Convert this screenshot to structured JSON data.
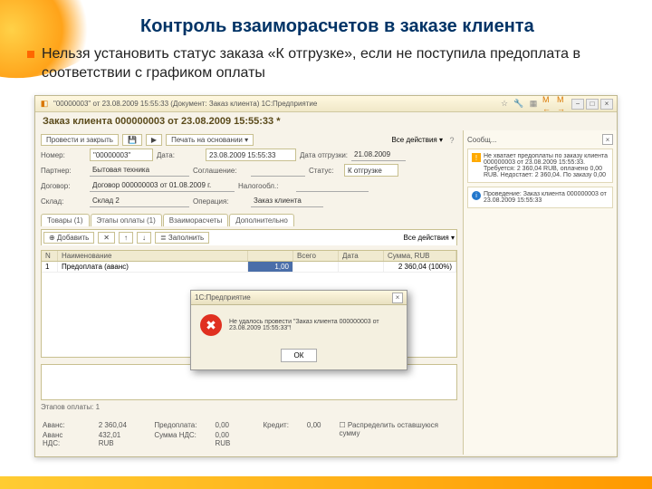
{
  "slide": {
    "title": "Контроль взаиморасчетов в заказе клиента",
    "bullet": "Нельзя установить статус заказа «К отгрузке», если не поступила предоплата в соответствии с графиком оплаты"
  },
  "window": {
    "titlebar": "\"00000003\" от 23.08.2009 15:55:33  (Документ: Заказ клиента)  1С:Предприятие",
    "nav_prev": "М ←",
    "nav_next": "М →",
    "min": "−",
    "max": "□",
    "close": "×"
  },
  "doc": {
    "title": "Заказ клиента 000000003 от 23.08.2009 15:55:33 *",
    "toolbar": {
      "post_close": "Провести и закрыть",
      "save_icon": "💾",
      "post_icon": "▶",
      "print": "Печать на основании ▾",
      "actions_label": "Все действия ▾",
      "help": "?"
    },
    "fields": {
      "number_label": "Номер:",
      "number": "\"00000003\"",
      "date_label": "Дата:",
      "date": "23.08.2009 15:55:33",
      "ship_label": "Дата отгрузки:",
      "ship": "21.08.2009",
      "partner_label": "Партнер:",
      "partner": "Бытовая техника",
      "agreement_label": "Соглашение:",
      "agreement": "",
      "contract_label": "Договор:",
      "contract": "Договор 000000003 от 01.08.2009 г.",
      "warehouse_label": "Склад:",
      "warehouse": "Склад 2",
      "status_label": "Статус:",
      "status": "К отгрузке",
      "tax_label": "Налогообл.:",
      "tax": "",
      "operation_label": "Операция:",
      "operation": "Заказ клиента"
    },
    "tabs": [
      "Товары (1)",
      "Этапы оплаты (1)",
      "Взаиморасчеты",
      "Дополнительно"
    ],
    "sub_toolbar": {
      "add": "⊕ Добавить",
      "del": "✕",
      "up": "↑",
      "down": "↓",
      "fill": "≣ Заполнить"
    },
    "table": {
      "headers": [
        "N",
        "Наименование",
        "",
        "Всего",
        "Дата",
        "Сумма, RUB"
      ],
      "row": {
        "n": "1",
        "name": "Предоплата (аванс)",
        "col3": "1,00",
        "total": "",
        "date": "",
        "sum": "2 360,04 (100%)"
      }
    },
    "bottom": {
      "items_label": "Этапов оплаты: 1",
      "rows": [
        {
          "label": "Аванс:",
          "val1": "2 360,04",
          "label2": "Предоплата:",
          "val2": "0,00",
          "label3": "Кредит:",
          "val3": "0,00",
          "check": "☐ Распределить оставшуюся сумму"
        },
        {
          "label": "Аванс НДС:",
          "val1": "432,01 RUB",
          "label2": "Сумма НДС:",
          "val2": "0,00 RUB"
        }
      ]
    }
  },
  "side": {
    "header": "Сообщ...",
    "close": "×",
    "msg1": {
      "icon": "!",
      "text": "Не хватает предоплаты по заказу клиента 000000003 от 23.08.2009 15:55:33. Требуется: 2 360,04 RUB, оплачено 0,00 RUB. Недостает: 2 360,04. По заказу 0,00"
    },
    "msg2": {
      "icon": "i",
      "text": "Проведение: Заказ клиента 000000003 от 23.08.2009 15:55:33"
    }
  },
  "modal": {
    "title": "1С:Предприятие",
    "close": "×",
    "text": "Не удалось провести \"Заказ клиента 000000003 от 23.08.2009 15:55:33\"!",
    "ok": "ОК"
  }
}
